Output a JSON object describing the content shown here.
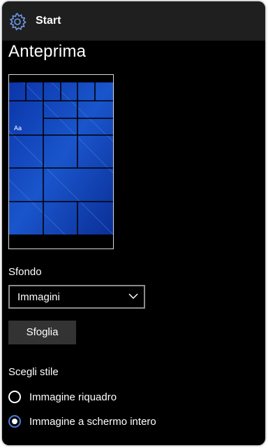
{
  "header": {
    "title": "Start",
    "icon": "gear-icon"
  },
  "preview": {
    "heading": "Anteprima",
    "tile_text": "Aa",
    "accent": "#1e56c8"
  },
  "background": {
    "label": "Sfondo",
    "selected": "Immagini",
    "browse_label": "Sfoglia"
  },
  "style": {
    "label": "Scegli stile",
    "options": [
      {
        "label": "Immagine riquadro",
        "selected": false
      },
      {
        "label": "Immagine a schermo intero",
        "selected": true
      }
    ]
  },
  "colors": {
    "accent_radio": "#4a7bd8",
    "header_bg": "#1f1f1f"
  }
}
